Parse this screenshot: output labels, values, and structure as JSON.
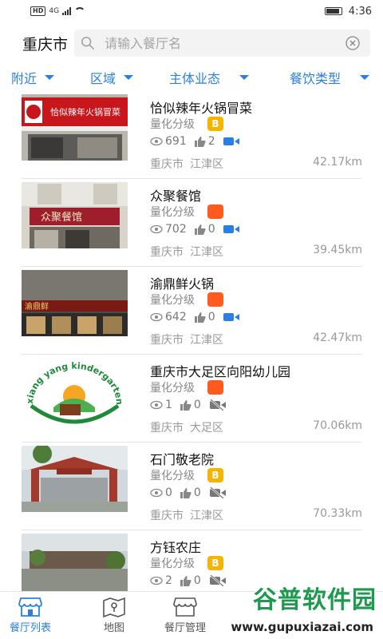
{
  "status_bar": {
    "hd": "HD",
    "network": "4G",
    "time": "4:36"
  },
  "search": {
    "city": "重庆市",
    "placeholder": "请输入餐厅名"
  },
  "filters": [
    {
      "label": "附近"
    },
    {
      "label": "区域"
    },
    {
      "label": "主体业态"
    },
    {
      "label": "餐饮类型"
    }
  ],
  "list": {
    "grade_label": "量化分级",
    "items": [
      {
        "title": "恰似辣年火锅冒菜",
        "grade": "B",
        "grade_color": "#f5b400",
        "views": "691",
        "likes": "2",
        "camera": "on",
        "city": "重庆市",
        "district": "江津区",
        "distance": "42.17km",
        "sign_text": "恰似辣年火锅冒菜"
      },
      {
        "title": "众聚餐馆",
        "grade": "",
        "grade_color": "#ff5a1f",
        "views": "702",
        "likes": "0",
        "camera": "on",
        "city": "重庆市",
        "district": "江津区",
        "distance": "39.45km",
        "sign_text": "众聚餐馆"
      },
      {
        "title": "渝鼎鲜火锅",
        "grade": "",
        "grade_color": "#ff5a1f",
        "views": "642",
        "likes": "0",
        "camera": "on",
        "city": "重庆市",
        "district": "江津区",
        "distance": "42.47km",
        "sign_text": "渝鼎鲜"
      },
      {
        "title": "重庆市大足区向阳幼儿园",
        "grade": "",
        "grade_color": "#ff5a1f",
        "views": "1",
        "likes": "0",
        "camera": "off",
        "city": "重庆市",
        "district": "大足区",
        "distance": "70.06km",
        "sign_text": "xiang yang kindergarten"
      },
      {
        "title": "石门敬老院",
        "grade": "B",
        "grade_color": "#f5b400",
        "views": "0",
        "likes": "0",
        "camera": "off",
        "city": "重庆市",
        "district": "江津区",
        "distance": "70.33km",
        "sign_text": ""
      },
      {
        "title": "方钰农庄",
        "grade": "B",
        "grade_color": "#f5b400",
        "views": "2",
        "likes": "0",
        "camera": "off",
        "city": "",
        "district": "",
        "distance": "",
        "sign_text": ""
      }
    ]
  },
  "bottom_nav": [
    {
      "label": "餐厅列表",
      "active": true
    },
    {
      "label": "地图",
      "active": false
    },
    {
      "label": "餐厅管理",
      "active": false
    }
  ],
  "watermark": {
    "title": "谷普软件园",
    "url": "www.gupuxiazai.com"
  },
  "colors": {
    "accent": "#2a7fe0",
    "grade_b": "#f5b400",
    "grade_red": "#ff5a1f",
    "video_icon": "#2a7fe0"
  }
}
